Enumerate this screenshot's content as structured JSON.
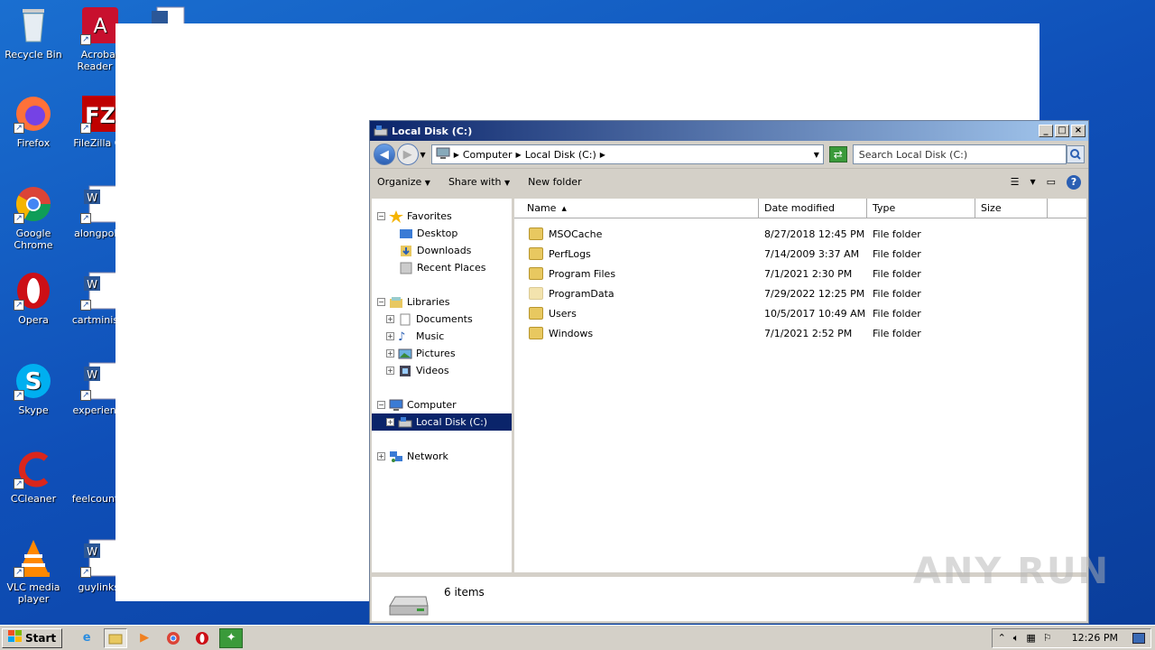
{
  "desktop": {
    "icons": [
      {
        "label": "Recycle Bin",
        "icon": "recycle-bin-icon"
      },
      {
        "label": "Acrobat Reader D",
        "icon": "acrobat-icon"
      },
      {
        "label": "Firefox",
        "icon": "firefox-icon"
      },
      {
        "label": "FileZilla Cli",
        "icon": "filezilla-icon"
      },
      {
        "label": "Google Chrome",
        "icon": "chrome-icon"
      },
      {
        "label": "alongpoliti",
        "icon": "word-doc-icon"
      },
      {
        "label": "Opera",
        "icon": "opera-icon"
      },
      {
        "label": "cartministe",
        "icon": "word-doc-icon"
      },
      {
        "label": "Skype",
        "icon": "skype-icon"
      },
      {
        "label": "experience",
        "icon": "word-doc-icon"
      },
      {
        "label": "CCleaner",
        "icon": "ccleaner-icon"
      },
      {
        "label": "feelcountry",
        "icon": "blank-file-icon"
      },
      {
        "label": "VLC media player",
        "icon": "vlc-icon"
      },
      {
        "label": "guylinks.",
        "icon": "word-doc-icon"
      }
    ]
  },
  "window": {
    "title": "Local Disk (C:)",
    "buttons": {
      "minimize": "_",
      "maximize": "□",
      "close": "×"
    },
    "breadcrumb": [
      "Computer",
      "Local Disk (C:)"
    ],
    "search_placeholder": "Search Local Disk (C:)",
    "toolbar": {
      "organize": "Organize",
      "share": "Share with",
      "new_folder": "New folder"
    },
    "nav": {
      "favorites": "Favorites",
      "favorites_items": [
        "Desktop",
        "Downloads",
        "Recent Places"
      ],
      "libraries": "Libraries",
      "libraries_items": [
        "Documents",
        "Music",
        "Pictures",
        "Videos"
      ],
      "computer": "Computer",
      "computer_items": [
        "Local Disk (C:)"
      ],
      "network": "Network"
    },
    "columns": {
      "name": "Name",
      "date": "Date modified",
      "type": "Type",
      "size": "Size"
    },
    "files": [
      {
        "name": "MSOCache",
        "date": "8/27/2018 12:45 PM",
        "type": "File folder"
      },
      {
        "name": "PerfLogs",
        "date": "7/14/2009 3:37 AM",
        "type": "File folder"
      },
      {
        "name": "Program Files",
        "date": "7/1/2021 2:30 PM",
        "type": "File folder"
      },
      {
        "name": "ProgramData",
        "date": "7/29/2022 12:25 PM",
        "type": "File folder"
      },
      {
        "name": "Users",
        "date": "10/5/2017 10:49 AM",
        "type": "File folder"
      },
      {
        "name": "Windows",
        "date": "7/1/2021 2:52 PM",
        "type": "File folder"
      }
    ],
    "status": "6 items"
  },
  "taskbar": {
    "start": "Start",
    "clock": "12:26 PM"
  },
  "watermark": "ANY RUN"
}
